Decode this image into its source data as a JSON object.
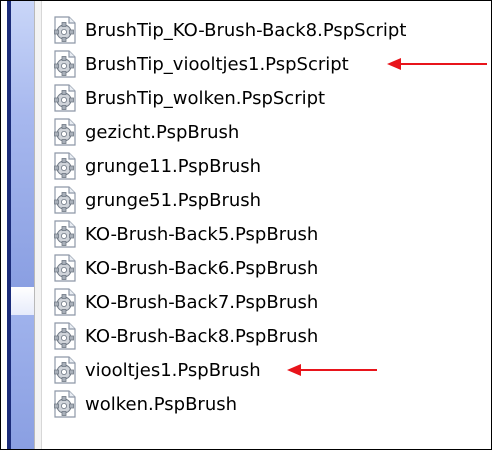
{
  "files": [
    {
      "name": "BrushTip_KO-Brush-Back8.PspScript",
      "icon": "gear-file-icon"
    },
    {
      "name": "BrushTip_viooltjes1.PspScript",
      "icon": "gear-file-icon",
      "marked": true
    },
    {
      "name": "BrushTip_wolken.PspScript",
      "icon": "gear-file-icon"
    },
    {
      "name": "gezicht.PspBrush",
      "icon": "gear-file-icon"
    },
    {
      "name": "grunge11.PspBrush",
      "icon": "gear-file-icon"
    },
    {
      "name": "grunge51.PspBrush",
      "icon": "gear-file-icon"
    },
    {
      "name": "KO-Brush-Back5.PspBrush",
      "icon": "gear-file-icon"
    },
    {
      "name": "KO-Brush-Back6.PspBrush",
      "icon": "gear-file-icon"
    },
    {
      "name": "KO-Brush-Back7.PspBrush",
      "icon": "gear-file-icon"
    },
    {
      "name": "KO-Brush-Back8.PspBrush",
      "icon": "gear-file-icon"
    },
    {
      "name": "viooltjes1.PspBrush",
      "icon": "gear-file-icon",
      "marked": true
    },
    {
      "name": "wolken.PspBrush",
      "icon": "gear-file-icon"
    }
  ],
  "colors": {
    "arrow": "#e8141b",
    "sidebar_dark": "#1b2c7a",
    "sidebar_light": "#a7b8ee"
  }
}
